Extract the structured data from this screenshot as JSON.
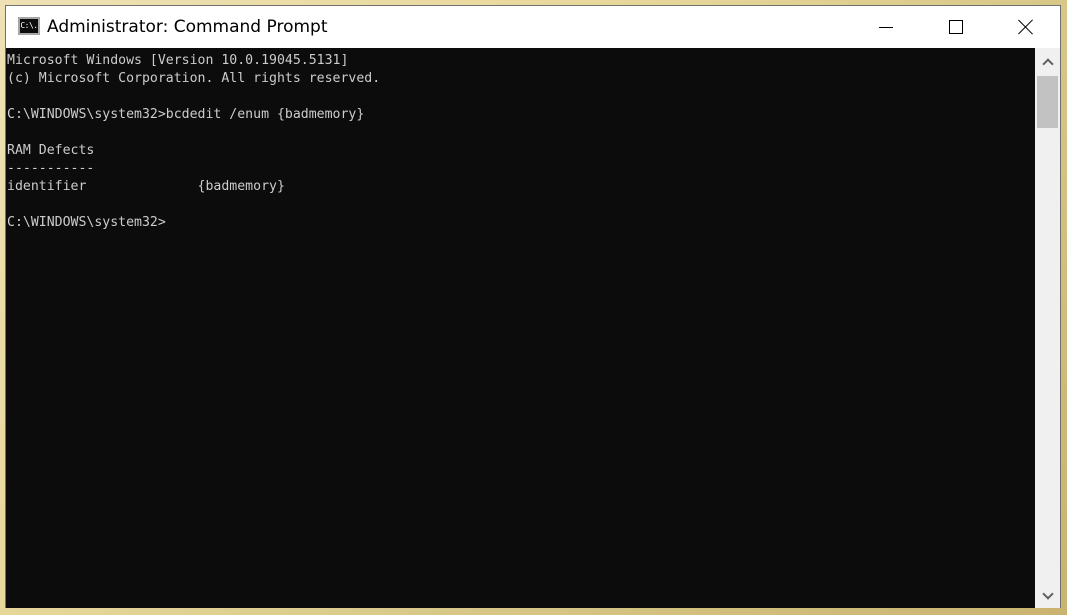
{
  "window": {
    "title": "Administrator: Command Prompt",
    "icon_label": "C:\\.",
    "icon": "command-prompt-icon",
    "controls": [
      "minimize-icon",
      "maximize-icon",
      "close-icon"
    ]
  },
  "console": {
    "background": "#0c0c0c",
    "foreground": "#cccccc",
    "lines": [
      "Microsoft Windows [Version 10.0.19045.5131]",
      "(c) Microsoft Corporation. All rights reserved.",
      "",
      "C:\\WINDOWS\\system32>bcdedit /enum {badmemory}",
      "",
      "RAM Defects",
      "-----------",
      "identifier              {badmemory}",
      "",
      "C:\\WINDOWS\\system32>"
    ]
  }
}
